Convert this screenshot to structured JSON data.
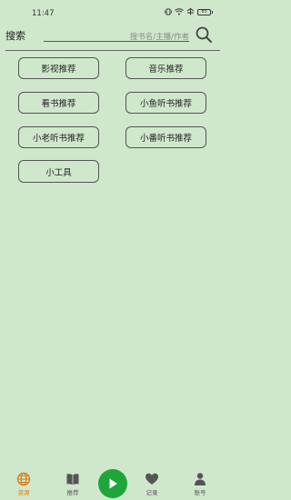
{
  "status_bar": {
    "time": "11:47",
    "battery": "85"
  },
  "search": {
    "label": "搜索",
    "placeholder": "搜书名/主播/作者"
  },
  "menu": {
    "film_label": "影视推荐",
    "music_label": "音乐推荐",
    "books_label": "看书推荐",
    "xiaoyu_label": "小鱼听书推荐",
    "xiaolao_label": "小老听书推荐",
    "xiaofan_label": "小番听书推荐",
    "tools_label": "小工具"
  },
  "bottom_nav": {
    "resources_label": "资源",
    "recommend_label": "推荐",
    "records_label": "记录",
    "account_label": "账号",
    "active_tab": "资源"
  },
  "colors": {
    "background": "#cfe8cc",
    "accent_orange": "#d9801a",
    "play_green": "#1ea63a"
  },
  "icons": {
    "resources": "globe-icon",
    "recommend": "book-icon",
    "play": "play-icon",
    "records": "heart-icon",
    "account": "person-icon",
    "search": "search-icon"
  }
}
